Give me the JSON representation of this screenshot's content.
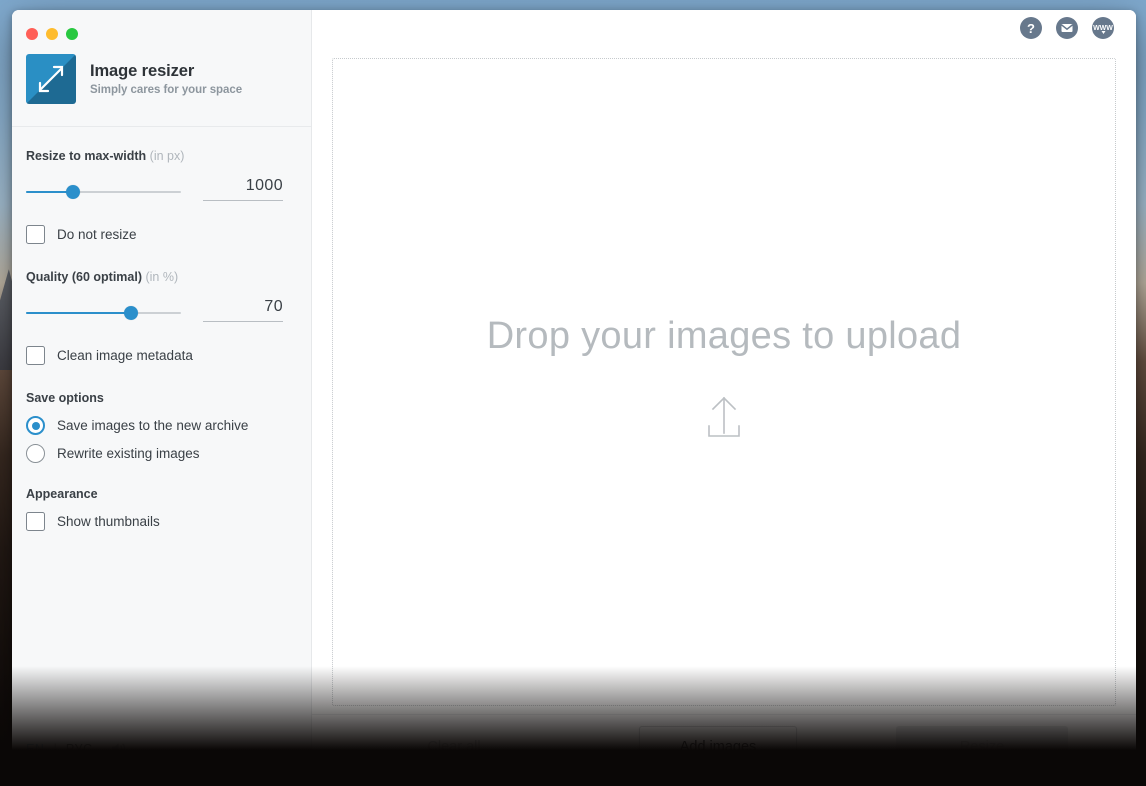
{
  "window": {
    "traffic_lights": [
      "close",
      "minimize",
      "maximize"
    ],
    "app_title": "Image resizer",
    "app_subtitle": "Simply cares for your space",
    "app_icon_name": "resize-diagonal-arrow-icon"
  },
  "titlebar": {
    "icons": [
      {
        "name": "help-icon",
        "glyph": "?"
      },
      {
        "name": "mail-icon",
        "glyph": "envelope"
      },
      {
        "name": "www-icon",
        "glyph": "www"
      }
    ]
  },
  "sidebar": {
    "width_group": {
      "label": "Resize to max-width",
      "unit": "(in px)",
      "value": "1000",
      "slider_percent": 30
    },
    "do_not_resize": {
      "label": "Do not resize",
      "checked": false
    },
    "quality_group": {
      "label": "Quality (60 optimal)",
      "unit": "(in %)",
      "value": "70",
      "slider_percent": 68
    },
    "clean_metadata": {
      "label": "Clean image metadata",
      "checked": false
    },
    "save_options": {
      "title": "Save options",
      "options": [
        {
          "label": "Save images to the new archive",
          "selected": true
        },
        {
          "label": "Rewrite existing images",
          "selected": false
        }
      ]
    },
    "appearance": {
      "title": "Appearance",
      "show_thumbnails": {
        "label": "Show thumbnails",
        "checked": false
      }
    },
    "languages": {
      "active": "EN",
      "separator": "|",
      "other": "РУС",
      "sound_icon": "speaker-icon"
    }
  },
  "main": {
    "dropzone": {
      "text": "Drop your images to upload",
      "icon_name": "upload-arrow-icon"
    },
    "footer": {
      "clear_all": "Clear all",
      "add_images": "Add images",
      "resize": "Resize"
    }
  },
  "colors": {
    "accent": "#2b8fcb",
    "sidebar_bg": "#f7f8f9",
    "icon_circle": "#67788c",
    "muted_text": "#b5babe"
  }
}
